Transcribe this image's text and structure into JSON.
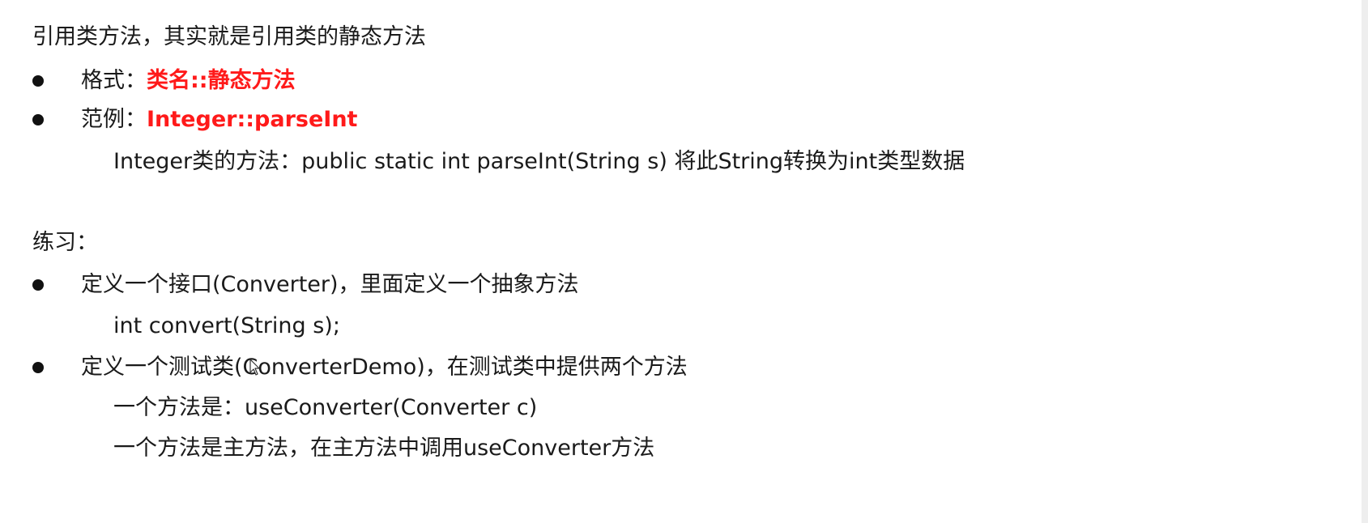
{
  "intro": "引用类方法，其实就是引用类的静态方法",
  "format": {
    "label": "格式：",
    "value": "类名::静态方法"
  },
  "example": {
    "label": "范例：",
    "value": "Integer::parseInt",
    "description": "Integer类的方法：public static int parseInt(String s) 将此String转换为int类型数据"
  },
  "exercise": {
    "heading": "练习：",
    "item1": "定义一个接口(Converter)，里面定义一个抽象方法",
    "item1_detail": "int convert(String s);",
    "item2": "定义一个测试类(ConverterDemo)，在测试类中提供两个方法",
    "item2_detail1": "一个方法是：useConverter(Converter c)",
    "item2_detail2": "一个方法是主方法，在主方法中调用useConverter方法"
  }
}
